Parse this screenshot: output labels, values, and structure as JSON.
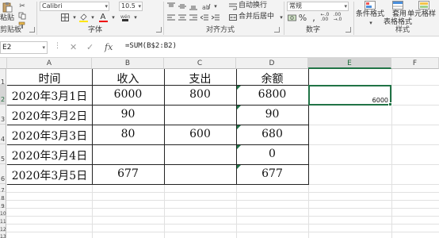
{
  "ribbon": {
    "paste_label": "粘贴",
    "font_name": "Calibri",
    "font_size": "10.5",
    "wrap_label": "自动换行",
    "merge_label": "合并后居中",
    "number_format": "常规",
    "cond_format_label": "条件格式",
    "table_format_label_1": "套用",
    "table_format_label_2": "表格格式",
    "cell_style_label": "单元格样",
    "groups": {
      "clipboard": "剪贴板",
      "font": "字体",
      "alignment": "对齐方式",
      "number": "数字",
      "styles": "样式"
    }
  },
  "formula_bar": {
    "name_box": "E2",
    "formula": "=SUM(B$2:B2)",
    "cancel_icon": "✕",
    "enter_icon": "✓",
    "fx_label": "fx"
  },
  "sheet": {
    "columns": [
      "A",
      "B",
      "C",
      "D",
      "E",
      "F"
    ],
    "selected_column": "E",
    "rows": [
      "1",
      "2",
      "3",
      "4",
      "5",
      "6",
      "7",
      "8",
      "9",
      "10",
      "11",
      "12",
      "13"
    ],
    "selected_row": "2",
    "table": {
      "headers": [
        "时间",
        "收入",
        "支出",
        "余额"
      ],
      "data": [
        [
          "2020年3月1日",
          "6000",
          "800",
          "6800"
        ],
        [
          "2020年3月2日",
          "90",
          "",
          "90"
        ],
        [
          "2020年3月3日",
          "80",
          "600",
          "680"
        ],
        [
          "2020年3月4日",
          "",
          "",
          "0"
        ],
        [
          "2020年3月5日",
          "677",
          "",
          "677"
        ]
      ]
    },
    "selected_cell_value": "6000"
  },
  "colors": {
    "accent": "#217346",
    "header_bg": "#f0f0f0",
    "ribbon_bg": "#f3f3f3"
  }
}
